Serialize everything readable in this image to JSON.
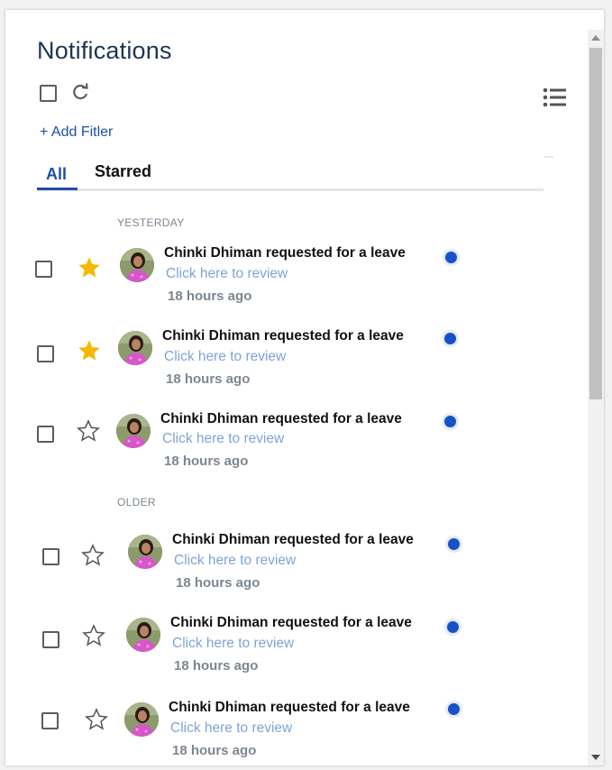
{
  "header": {
    "title": "Notifications",
    "add_filter_label": "+ Add Fitler"
  },
  "tabs": [
    {
      "label": "All",
      "active": true
    },
    {
      "label": "Starred",
      "active": false
    }
  ],
  "sections": {
    "yesterday": "YESTERDAY",
    "older": "OLDER"
  },
  "notifications": [
    {
      "title": "Chinki Dhiman requested for a leave",
      "link": "Click here to review",
      "time": "18 hours ago",
      "starred": true,
      "unread": true
    },
    {
      "title": "Chinki Dhiman requested for a leave",
      "link": "Click here to review",
      "time": "18 hours ago",
      "starred": true,
      "unread": true
    },
    {
      "title": "Chinki Dhiman requested for a leave",
      "link": "Click here to review",
      "time": "18 hours ago",
      "starred": false,
      "unread": true
    },
    {
      "title": "Chinki Dhiman requested for a leave",
      "link": "Click here to review",
      "time": "18 hours ago",
      "starred": false,
      "unread": true
    },
    {
      "title": "Chinki Dhiman requested for a leave",
      "link": "Click here to review",
      "time": "18 hours ago",
      "starred": false,
      "unread": true
    },
    {
      "title": "Chinki Dhiman requested for a leave",
      "link": "Click here to review",
      "time": "18 hours ago",
      "starred": false,
      "unread": true
    }
  ],
  "icons": {
    "refresh": "refresh-icon",
    "list_menu": "list-menu-icon",
    "star": "star-icon",
    "unread_dot": "unread-dot-icon"
  },
  "colors": {
    "accent": "#1f4fa6",
    "star_filled": "#f5b800",
    "unread_dot": "#1751c8",
    "link": "#7ea4d6",
    "title": "#1e3553"
  }
}
